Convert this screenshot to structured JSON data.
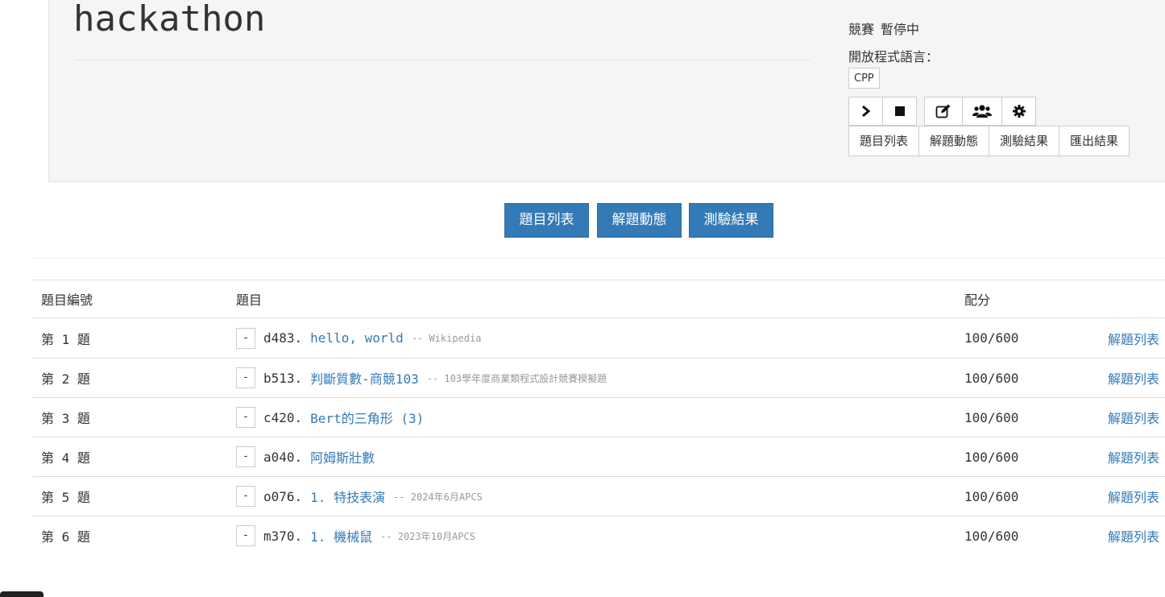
{
  "contest": {
    "title": "hackathon",
    "status_label": "競賽",
    "status_value": "暫停中",
    "languages_label": "開放程式語言：",
    "languages": [
      "CPP"
    ]
  },
  "icons": {
    "start": "chevron-right-icon",
    "stop": "stop-icon",
    "edit": "edit-icon",
    "users": "users-icon",
    "settings": "gear-icon"
  },
  "header_buttons": [
    "題目列表",
    "解題動態",
    "測驗結果",
    "匯出結果"
  ],
  "nav_buttons": [
    "題目列表",
    "解題動態",
    "測驗結果"
  ],
  "table": {
    "headers": {
      "number": "題目編號",
      "problem": "題目",
      "score": "配分"
    },
    "rows": [
      {
        "number": "第 1 題",
        "toggle": "-",
        "id": "d483.",
        "title": "hello, world",
        "source": "-- Wikipedia",
        "score": "100/600",
        "link": "解題列表"
      },
      {
        "number": "第 2 題",
        "toggle": "-",
        "id": "b513.",
        "title": "判斷質數-商競103",
        "source": "-- 103學年度商業類程式設計競賽模擬題",
        "score": "100/600",
        "link": "解題列表"
      },
      {
        "number": "第 3 題",
        "toggle": "-",
        "id": "c420.",
        "title": "Bert的三角形 (3)",
        "source": "",
        "score": "100/600",
        "link": "解題列表"
      },
      {
        "number": "第 4 題",
        "toggle": "-",
        "id": "a040.",
        "title": "阿姆斯壯數",
        "source": "",
        "score": "100/600",
        "link": "解題列表"
      },
      {
        "number": "第 5 題",
        "toggle": "-",
        "id": "o076.",
        "title": "1. 特技表演",
        "source": "-- 2024年6月APCS",
        "score": "100/600",
        "link": "解題列表"
      },
      {
        "number": "第 6 題",
        "toggle": "-",
        "id": "m370.",
        "title": "1. 機械鼠",
        "source": "-- 2023年10月APCS",
        "score": "100/600",
        "link": "解題列表"
      }
    ]
  },
  "colors": {
    "primary": "#337ab7",
    "panel_bg": "#f5f5f5",
    "muted": "#999999"
  }
}
